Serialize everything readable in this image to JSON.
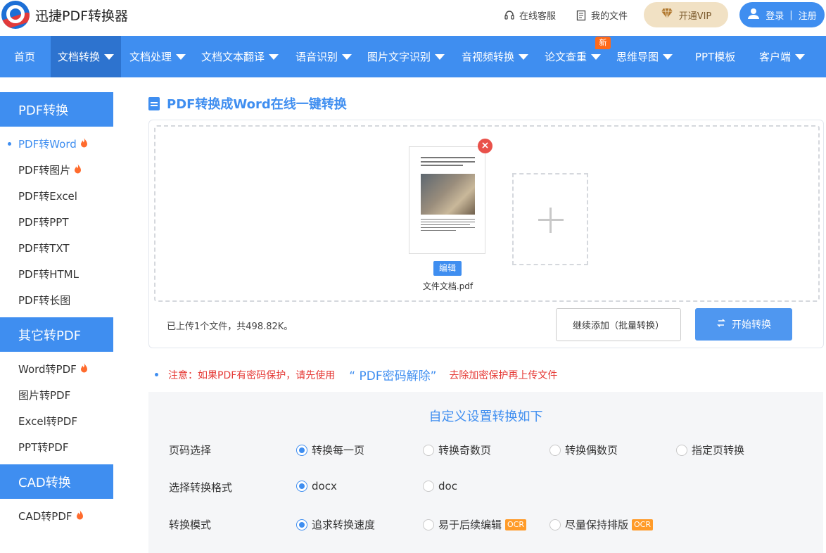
{
  "header": {
    "brand": "迅捷PDF转换器",
    "service": "在线客服",
    "my_files": "我的文件",
    "vip": "开通VIP",
    "login": "登录",
    "register": "注册"
  },
  "nav": {
    "items": [
      {
        "label": "首页"
      },
      {
        "label": "文档转换"
      },
      {
        "label": "文档处理"
      },
      {
        "label": "文档文本翻译"
      },
      {
        "label": "语音识别"
      },
      {
        "label": "图片文字识别"
      },
      {
        "label": "音视频转换"
      },
      {
        "label": "论文查重"
      },
      {
        "label": "思维导图"
      },
      {
        "label": "PPT模板"
      },
      {
        "label": "客户端"
      }
    ],
    "new_badge": "新",
    "active_index": 1
  },
  "sidebar": {
    "groups": [
      {
        "title": "PDF转换",
        "items": [
          "PDF转Word",
          "PDF转图片",
          "PDF转Excel",
          "PDF转PPT",
          "PDF转TXT",
          "PDF转HTML",
          "PDF转长图"
        ]
      },
      {
        "title": "其它转PDF",
        "items": [
          "Word转PDF",
          "图片转PDF",
          "Excel转PDF",
          "PPT转PDF"
        ]
      },
      {
        "title": "CAD转换",
        "items": [
          "CAD转PDF"
        ]
      }
    ]
  },
  "main": {
    "title": "PDF转换成Word在线一键转换",
    "file": {
      "edit_label": "编辑",
      "name": "文件文档.pdf"
    },
    "upload_status": "已上传1个文件，共498.82K。",
    "continue_button": "继续添加（批量转换）",
    "start_button": "开始转换"
  },
  "notice": {
    "prefix": "注意：如果PDF有密码保护，请先使用",
    "link": "“ PDF密码解除”",
    "suffix": "去除加密保护再上传文件"
  },
  "settings": {
    "title": "自定义设置转换如下",
    "rows": [
      {
        "label": "页码选择",
        "options": [
          {
            "label": "转换每一页",
            "checked": true
          },
          {
            "label": "转换奇数页",
            "checked": false
          },
          {
            "label": "转换偶数页",
            "checked": false
          },
          {
            "label": "指定页转换",
            "checked": false
          }
        ]
      },
      {
        "label": "选择转换格式",
        "options": [
          {
            "label": "docx",
            "checked": true
          },
          {
            "label": "doc",
            "checked": false
          }
        ]
      },
      {
        "label": "转换模式",
        "options": [
          {
            "label": "追求转换速度",
            "checked": true
          },
          {
            "label": "易于后续编辑",
            "checked": false,
            "badge": "OCR"
          },
          {
            "label": "尽量保持排版",
            "checked": false,
            "badge": "OCR"
          }
        ]
      }
    ]
  },
  "colors": {
    "primary": "#3f8ef0",
    "nav_active": "#2d73cf",
    "notice": "#e53935",
    "ocr_badge": "#ff9b29",
    "new_badge": "#ff6a1a"
  }
}
